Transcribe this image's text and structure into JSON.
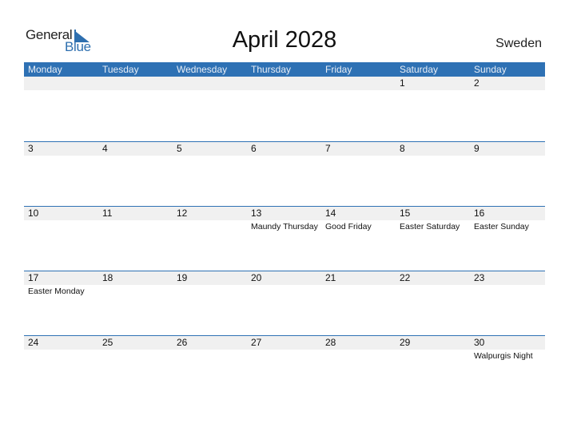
{
  "logo": {
    "text_general": "General",
    "text_blue": "Blue",
    "accent": "#2e6faf"
  },
  "title": "April 2028",
  "country": "Sweden",
  "colors": {
    "header_bg": "#2e71b4",
    "strip_bg": "#f0f0f0"
  },
  "days_of_week": [
    "Monday",
    "Tuesday",
    "Wednesday",
    "Thursday",
    "Friday",
    "Saturday",
    "Sunday"
  ],
  "weeks": [
    [
      {
        "day": ""
      },
      {
        "day": ""
      },
      {
        "day": ""
      },
      {
        "day": ""
      },
      {
        "day": ""
      },
      {
        "day": "1"
      },
      {
        "day": "2"
      }
    ],
    [
      {
        "day": "3"
      },
      {
        "day": "4"
      },
      {
        "day": "5"
      },
      {
        "day": "6"
      },
      {
        "day": "7"
      },
      {
        "day": "8"
      },
      {
        "day": "9"
      }
    ],
    [
      {
        "day": "10"
      },
      {
        "day": "11"
      },
      {
        "day": "12"
      },
      {
        "day": "13",
        "holiday": "Maundy Thursday"
      },
      {
        "day": "14",
        "holiday": "Good Friday"
      },
      {
        "day": "15",
        "holiday": "Easter Saturday"
      },
      {
        "day": "16",
        "holiday": "Easter Sunday"
      }
    ],
    [
      {
        "day": "17",
        "holiday": "Easter Monday"
      },
      {
        "day": "18"
      },
      {
        "day": "19"
      },
      {
        "day": "20"
      },
      {
        "day": "21"
      },
      {
        "day": "22"
      },
      {
        "day": "23"
      }
    ],
    [
      {
        "day": "24"
      },
      {
        "day": "25"
      },
      {
        "day": "26"
      },
      {
        "day": "27"
      },
      {
        "day": "28"
      },
      {
        "day": "29"
      },
      {
        "day": "30",
        "holiday": "Walpurgis Night"
      }
    ]
  ]
}
